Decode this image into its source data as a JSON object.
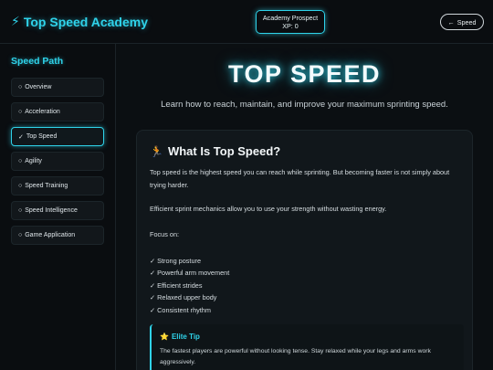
{
  "header": {
    "brand_icon": "⚡",
    "brand": "Top Speed Academy",
    "prospect_line1": "Academy Prospect",
    "prospect_line2": "XP: 0",
    "back_arrow": "←",
    "back_label": "Speed"
  },
  "sidebar": {
    "title": "Speed Path",
    "items": [
      {
        "marker": "○",
        "label": "Overview"
      },
      {
        "marker": "○",
        "label": "Acceleration"
      },
      {
        "marker": "✓",
        "label": "Top Speed"
      },
      {
        "marker": "○",
        "label": "Agility"
      },
      {
        "marker": "○",
        "label": "Speed Training"
      },
      {
        "marker": "○",
        "label": "Speed Intelligence"
      },
      {
        "marker": "○",
        "label": "Game Application"
      }
    ],
    "active_index": 2
  },
  "main": {
    "title": "TOP SPEED",
    "subtitle": "Learn how to reach, maintain, and improve your maximum sprinting speed.",
    "card": {
      "icon": "🏃",
      "title": "What Is Top Speed?",
      "para1": "Top speed is the highest speed you can reach while sprinting. But becoming faster is not simply about trying harder.",
      "para2": "Efficient sprint mechanics allow you to use your strength without wasting energy.",
      "focus_label": "Focus on:",
      "focus_items": [
        "✓ Strong posture",
        "✓ Powerful arm movement",
        "✓ Efficient strides",
        "✓ Relaxed upper body",
        "✓ Consistent rhythm"
      ],
      "tip": {
        "icon": "⭐",
        "title": "Elite Tip",
        "text": "The fastest players are powerful without looking tense. Stay relaxed while your legs and arms work aggressively."
      }
    }
  },
  "colors": {
    "accent": "#2fd3ea",
    "background": "#0b0f12",
    "card": "#11171b"
  }
}
